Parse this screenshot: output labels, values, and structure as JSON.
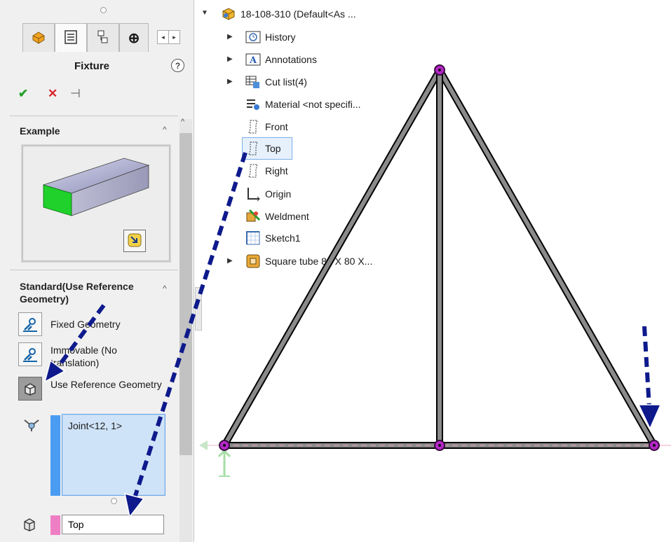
{
  "property_manager": {
    "title": "Fixture",
    "help_symbol": "?",
    "confirm_symbol": "✔",
    "cancel_symbol": "✕",
    "pin_symbol": "⊣",
    "tabs": [
      {
        "icon": "featuremanager-icon"
      },
      {
        "icon": "propertymanager-icon"
      },
      {
        "icon": "configurationmanager-icon"
      },
      {
        "icon": "dimxpert-icon"
      }
    ],
    "example_section": {
      "header": "Example",
      "collapse_symbol": "^"
    },
    "standard_section": {
      "header": "Standard(Use Reference Geometry)",
      "collapse_symbol": "^",
      "options": [
        {
          "label": "Fixed Geometry",
          "icon": "fixed-geometry-icon"
        },
        {
          "label": "Immovable (No translation)",
          "icon": "immovable-icon"
        },
        {
          "label": "Use Reference Geometry",
          "icon": "reference-geometry-icon",
          "selected": true
        }
      ],
      "faces_selection": [
        "Joint<12, 1>"
      ],
      "reference_selection": "Top"
    }
  },
  "feature_tree": {
    "root": "18-108-310  (Default<As ...",
    "items": [
      {
        "label": "History",
        "icon": "history-folder-icon",
        "expandable": true
      },
      {
        "label": "Annotations",
        "icon": "annotations-folder-icon",
        "expandable": true
      },
      {
        "label": "Cut list(4)",
        "icon": "cut-list-icon",
        "expandable": true
      },
      {
        "label": "Material <not specifi...",
        "icon": "material-icon",
        "expandable": false
      },
      {
        "label": "Front",
        "icon": "plane-icon",
        "expandable": false
      },
      {
        "label": "Top",
        "icon": "plane-icon",
        "expandable": false,
        "selected": true
      },
      {
        "label": "Right",
        "icon": "plane-icon",
        "expandable": false
      },
      {
        "label": "Origin",
        "icon": "origin-icon",
        "expandable": false
      },
      {
        "label": "Weldment",
        "icon": "weldment-icon",
        "expandable": false
      },
      {
        "label": "Sketch1",
        "icon": "sketch-icon",
        "expandable": false
      },
      {
        "label": "Square tube 80 X 80 X...",
        "icon": "structural-member-icon",
        "expandable": true
      }
    ]
  },
  "colors": {
    "joint": "#b526c8",
    "member": "#8a8a8a",
    "annotation_arrow": "#0e1a8c",
    "selection_blue": "#4a9cf2",
    "selection_pink": "#ef7fc4"
  }
}
